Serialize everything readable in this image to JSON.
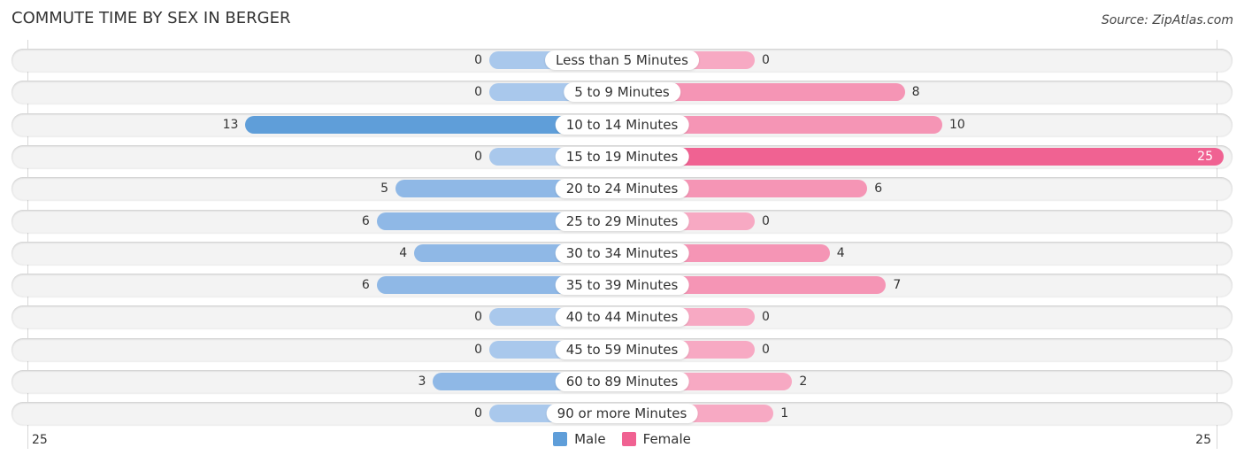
{
  "title": "COMMUTE TIME BY SEX IN BERGER",
  "source": "Source: ZipAtlas.com",
  "colors": {
    "male": "#5f9ed9",
    "male_light": "#a9c8ec",
    "female": "#f06292",
    "female_light": "#f7a9c3"
  },
  "chart_data": {
    "type": "bar",
    "orientation": "horizontal-diverging",
    "title": "COMMUTE TIME BY SEX IN BERGER",
    "categories": [
      "Less than 5 Minutes",
      "5 to 9 Minutes",
      "10 to 14 Minutes",
      "15 to 19 Minutes",
      "20 to 24 Minutes",
      "25 to 29 Minutes",
      "30 to 34 Minutes",
      "35 to 39 Minutes",
      "40 to 44 Minutes",
      "45 to 59 Minutes",
      "60 to 89 Minutes",
      "90 or more Minutes"
    ],
    "series": [
      {
        "name": "Male",
        "values": [
          0,
          0,
          13,
          0,
          5,
          6,
          4,
          6,
          0,
          0,
          3,
          0
        ]
      },
      {
        "name": "Female",
        "values": [
          0,
          8,
          10,
          25,
          6,
          0,
          4,
          7,
          0,
          0,
          2,
          1
        ]
      }
    ],
    "xlim": [
      25,
      25
    ],
    "tick_labels": {
      "left": "25",
      "right": "25"
    },
    "legend": [
      "Male",
      "Female"
    ],
    "legend_position": "bottom-center",
    "grid": false
  }
}
